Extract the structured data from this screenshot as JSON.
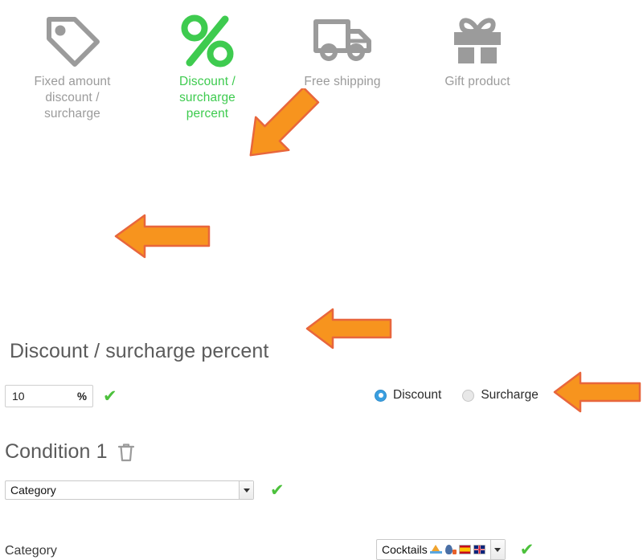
{
  "promo_types": [
    {
      "id": "fixed-amount",
      "label": "Fixed amount discount / surcharge",
      "icon": "price-tag-icon",
      "active": false
    },
    {
      "id": "percent",
      "label": "Discount / surcharge percent",
      "icon": "percent-icon",
      "active": true
    },
    {
      "id": "free-shipping",
      "label": "Free shipping",
      "icon": "truck-icon",
      "active": false
    },
    {
      "id": "gift-product",
      "label": "Gift product",
      "icon": "gift-icon",
      "active": false
    }
  ],
  "labels": {
    "type_1": "Fixed amount",
    "type_1b": "discount /",
    "type_1c": "surcharge",
    "type_2": "Discount /",
    "type_2b": "surcharge",
    "type_2c": "percent",
    "type_3": "Free shipping",
    "type_4": "Gift product"
  },
  "percent_section": {
    "title": "Discount / surcharge percent",
    "amount_value": "10",
    "amount_placeholder": "",
    "unit": "%",
    "valid_mark": "✔",
    "radios": [
      {
        "id": "discount",
        "label": "Discount",
        "selected": true
      },
      {
        "id": "surcharge",
        "label": "Surcharge",
        "selected": false
      }
    ]
  },
  "condition_section": {
    "title": "Condition 1",
    "delete_icon": "trash-icon",
    "type_select": {
      "value": "Category",
      "options": [
        "Category"
      ]
    },
    "valid_mark": "✔",
    "value_label": "Category",
    "value_select": {
      "value": "Cocktails",
      "glyphs": [
        "sailboat-glyph",
        "speaking-head-glyph",
        "flag-es-glyph",
        "flag-gb-glyph"
      ]
    },
    "value_valid_mark": "✔"
  },
  "annotations": {
    "arrow_color": "#f7941e",
    "arrow_border_color": "#e8663c",
    "arrows": [
      {
        "id": "arrow-to-percent-type",
        "direction": "up-left"
      },
      {
        "id": "arrow-to-amount-field",
        "direction": "left"
      },
      {
        "id": "arrow-to-condition-type",
        "direction": "left"
      },
      {
        "id": "arrow-to-category-value",
        "direction": "left"
      }
    ]
  },
  "colors": {
    "active_green": "#3ecb4f",
    "check_green": "#4cc13c",
    "icon_grey": "#9b9b9b",
    "radio_blue": "#3a9fe0"
  }
}
